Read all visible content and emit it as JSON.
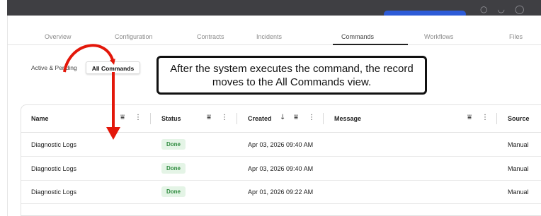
{
  "nav_tabs": [
    "Overview",
    "Configuration",
    "Contracts",
    "Incidents",
    "Commands",
    "Workflows",
    "Files"
  ],
  "active_tab": "Commands",
  "segment": {
    "items": [
      "Active & Pending",
      "All Commands"
    ],
    "selected": "All Commands"
  },
  "callout": "After the system executes the command, the record moves to the All Commands view.",
  "table": {
    "columns": [
      "Name",
      "Status",
      "Created",
      "Message",
      "Source"
    ],
    "sort_indicator": "↓",
    "rows": [
      {
        "name": "Diagnostic Logs",
        "status": "Done",
        "created": "Apr 03, 2026 09:40 AM",
        "message": "",
        "source": "Manual"
      },
      {
        "name": "Diagnostic Logs",
        "status": "Done",
        "created": "Apr 03, 2026 09:40 AM",
        "message": "",
        "source": "Manual"
      },
      {
        "name": "Diagnostic Logs",
        "status": "Done",
        "created": "Apr 01, 2026 09:22 AM",
        "message": "",
        "source": "Manual"
      }
    ]
  },
  "colors": {
    "annotation_arrow": "#e3170a",
    "status_done": "#2e8b3e",
    "topbar": "#3f3f43"
  },
  "icons": {
    "filter": "filter-icon",
    "menu": "kebab-menu-icon",
    "sort": "sort-down-icon"
  }
}
